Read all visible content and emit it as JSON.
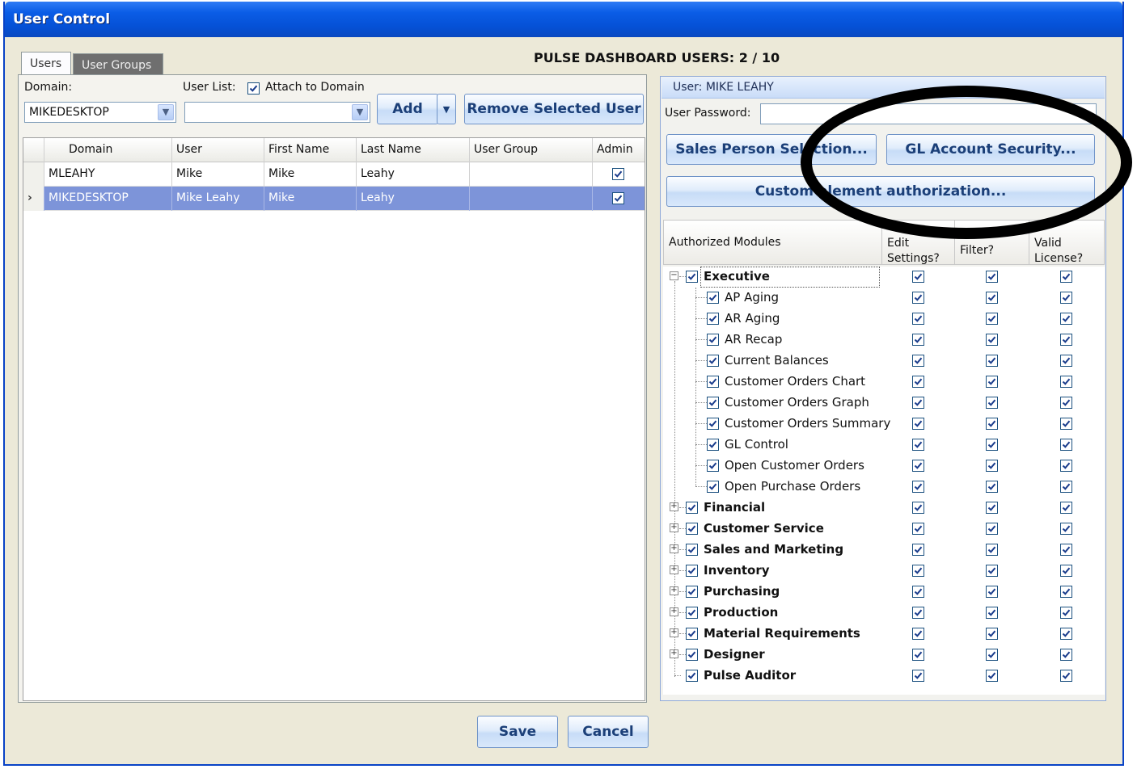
{
  "window": {
    "title": "User Control"
  },
  "tabs": [
    {
      "label": "Users",
      "active": true
    },
    {
      "label": "User Groups",
      "active": false
    }
  ],
  "header": {
    "summary": "PULSE DASHBOARD USERS: 2 / 10"
  },
  "filters": {
    "domain_label": "Domain:",
    "domain_value": "MIKEDESKTOP",
    "userlist_label": "User List:",
    "userlist_value": "",
    "attach_label": "Attach to Domain",
    "attach_checked": true
  },
  "toolbar": {
    "add_label": "Add",
    "remove_label": "Remove Selected User"
  },
  "grid": {
    "columns": [
      "Domain",
      "User",
      "First Name",
      "Last Name",
      "User Group",
      "Admin"
    ],
    "rows": [
      {
        "domain": "MLEAHY",
        "user": "Mike",
        "first": "Mike",
        "last": "Leahy",
        "group": "",
        "admin": true,
        "selected": false
      },
      {
        "domain": "MIKEDESKTOP",
        "user": "Mike Leahy",
        "first": "Mike",
        "last": "Leahy",
        "group": "",
        "admin": true,
        "selected": true
      }
    ]
  },
  "details": {
    "user_header": "User: MIKE LEAHY",
    "password_label": "User Password:",
    "password_value": "",
    "sales_btn": "Sales Person Selection...",
    "gl_btn": "GL Account Security...",
    "custom_btn": "Custom element authorization..."
  },
  "tree": {
    "columns": {
      "modules": "Authorized Modules",
      "edit": "Edit\nSettings?",
      "filter": "Filter?",
      "license": "Valid\nLicense?"
    },
    "items": [
      {
        "label": "Executive",
        "level": 0,
        "expander": "minus"
      },
      {
        "label": "AP Aging",
        "level": 1
      },
      {
        "label": "AR Aging",
        "level": 1
      },
      {
        "label": "AR Recap",
        "level": 1
      },
      {
        "label": "Current Balances",
        "level": 1
      },
      {
        "label": "Customer Orders Chart",
        "level": 1
      },
      {
        "label": "Customer Orders Graph",
        "level": 1
      },
      {
        "label": "Customer Orders Summary",
        "level": 1
      },
      {
        "label": "GL Control",
        "level": 1
      },
      {
        "label": "Open Customer Orders",
        "level": 1
      },
      {
        "label": "Open Purchase Orders",
        "level": 1
      },
      {
        "label": "Financial",
        "level": 0,
        "expander": "plus"
      },
      {
        "label": "Customer Service",
        "level": 0,
        "expander": "plus"
      },
      {
        "label": "Sales and Marketing",
        "level": 0,
        "expander": "plus"
      },
      {
        "label": "Inventory",
        "level": 0,
        "expander": "plus"
      },
      {
        "label": "Purchasing",
        "level": 0,
        "expander": "plus"
      },
      {
        "label": "Production",
        "level": 0,
        "expander": "plus"
      },
      {
        "label": "Material Requirements",
        "level": 0,
        "expander": "plus"
      },
      {
        "label": "Designer",
        "level": 0,
        "expander": "plus"
      },
      {
        "label": "Pulse Auditor",
        "level": 0,
        "expander": "none"
      }
    ]
  },
  "footer": {
    "save_label": "Save",
    "cancel_label": "Cancel"
  },
  "colors": {
    "titlebar": "#0551d6",
    "selection": "#7d94d9",
    "button_text": "#1b3f78",
    "annotation": "#000000"
  }
}
